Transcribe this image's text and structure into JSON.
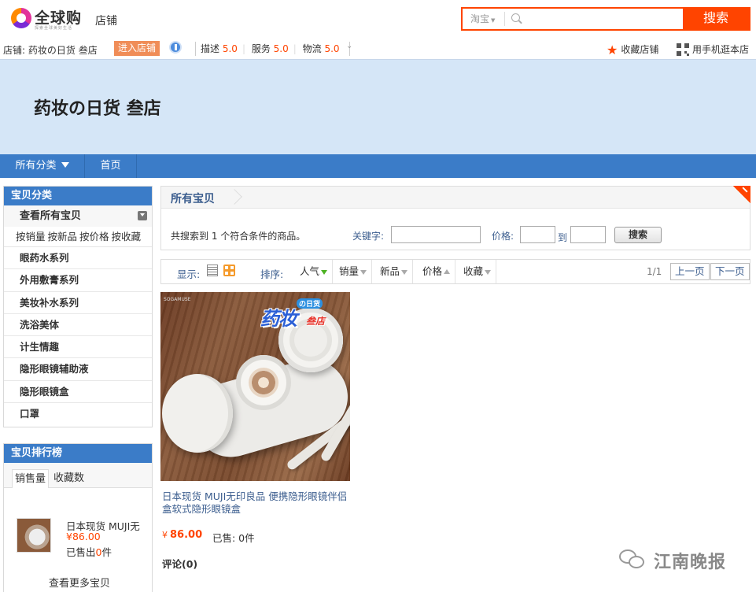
{
  "header": {
    "logo_text": "全球购",
    "logo_tagline": "探索全球美好生活",
    "shop_label": "店铺"
  },
  "search": {
    "scope": "淘宝",
    "placeholder": "",
    "button": "搜索"
  },
  "shop_info": {
    "name_label": "店铺:",
    "name": "药妆の日货 叁店",
    "enter_button": "进入店铺",
    "ratings": [
      {
        "label": "描述",
        "score": "5.0"
      },
      {
        "label": "服务",
        "score": "5.0"
      },
      {
        "label": "物流",
        "score": "5.0"
      }
    ],
    "favorite": "收藏店铺",
    "mobile": "用手机逛本店"
  },
  "banner": {
    "title": "药妆の日货 叁店"
  },
  "nav": {
    "categories": "所有分类",
    "home": "首页"
  },
  "sidebar": {
    "categories_title": "宝贝分类",
    "view_all": "查看所有宝贝",
    "sort_links": [
      "按销量",
      "按新品",
      "按价格",
      "按收藏"
    ],
    "categories": [
      "眼药水系列",
      "外用敷膏系列",
      "美妆补水系列",
      "洗浴美体",
      "计生情趣",
      "隐形眼镜辅助液",
      "隐形眼镜盒",
      "口罩"
    ],
    "ranking_title": "宝贝排行榜",
    "ranking_tabs": [
      "销售量",
      "收藏数"
    ],
    "ranking_item": {
      "name": "日本现货 MUJI无",
      "price": "¥86.00",
      "sold_prefix": "已售出",
      "sold_count": "0",
      "sold_suffix": "件"
    },
    "more": "查看更多宝贝"
  },
  "main": {
    "title": "所有宝贝",
    "summary": "共搜索到 1 个符合条件的商品。",
    "keyword_label": "关键字:",
    "keyword_value": "",
    "price_label": "价格:",
    "price_from": "",
    "price_to_label": "到",
    "price_to": "",
    "filter_button": "搜索",
    "display_label": "显示:",
    "sort_label": "排序:",
    "sort_options": [
      "人气",
      "销量",
      "新品",
      "价格",
      "收藏"
    ],
    "pager": {
      "count": "1/1",
      "prev": "上一页",
      "next": "下一页"
    }
  },
  "product": {
    "image_logo": "药妆",
    "image_logo_tag": "の日货",
    "image_logo_sub": "叁店",
    "image_brand": "SOGAMUSE",
    "name": "日本现货 MUJI无印良品 便携隐形眼镜伴侣盒软式隐形眼镜盒",
    "price_symbol": "¥",
    "price": "86.00",
    "sold": "已售: 0件",
    "comments": "评论(0)"
  },
  "watermark": {
    "text": "江南晚报"
  },
  "colors": {
    "accent": "#ff4400",
    "nav_blue": "#3b7cc8",
    "banner_bg": "#d5e6f7",
    "link": "#3b5d8e"
  }
}
